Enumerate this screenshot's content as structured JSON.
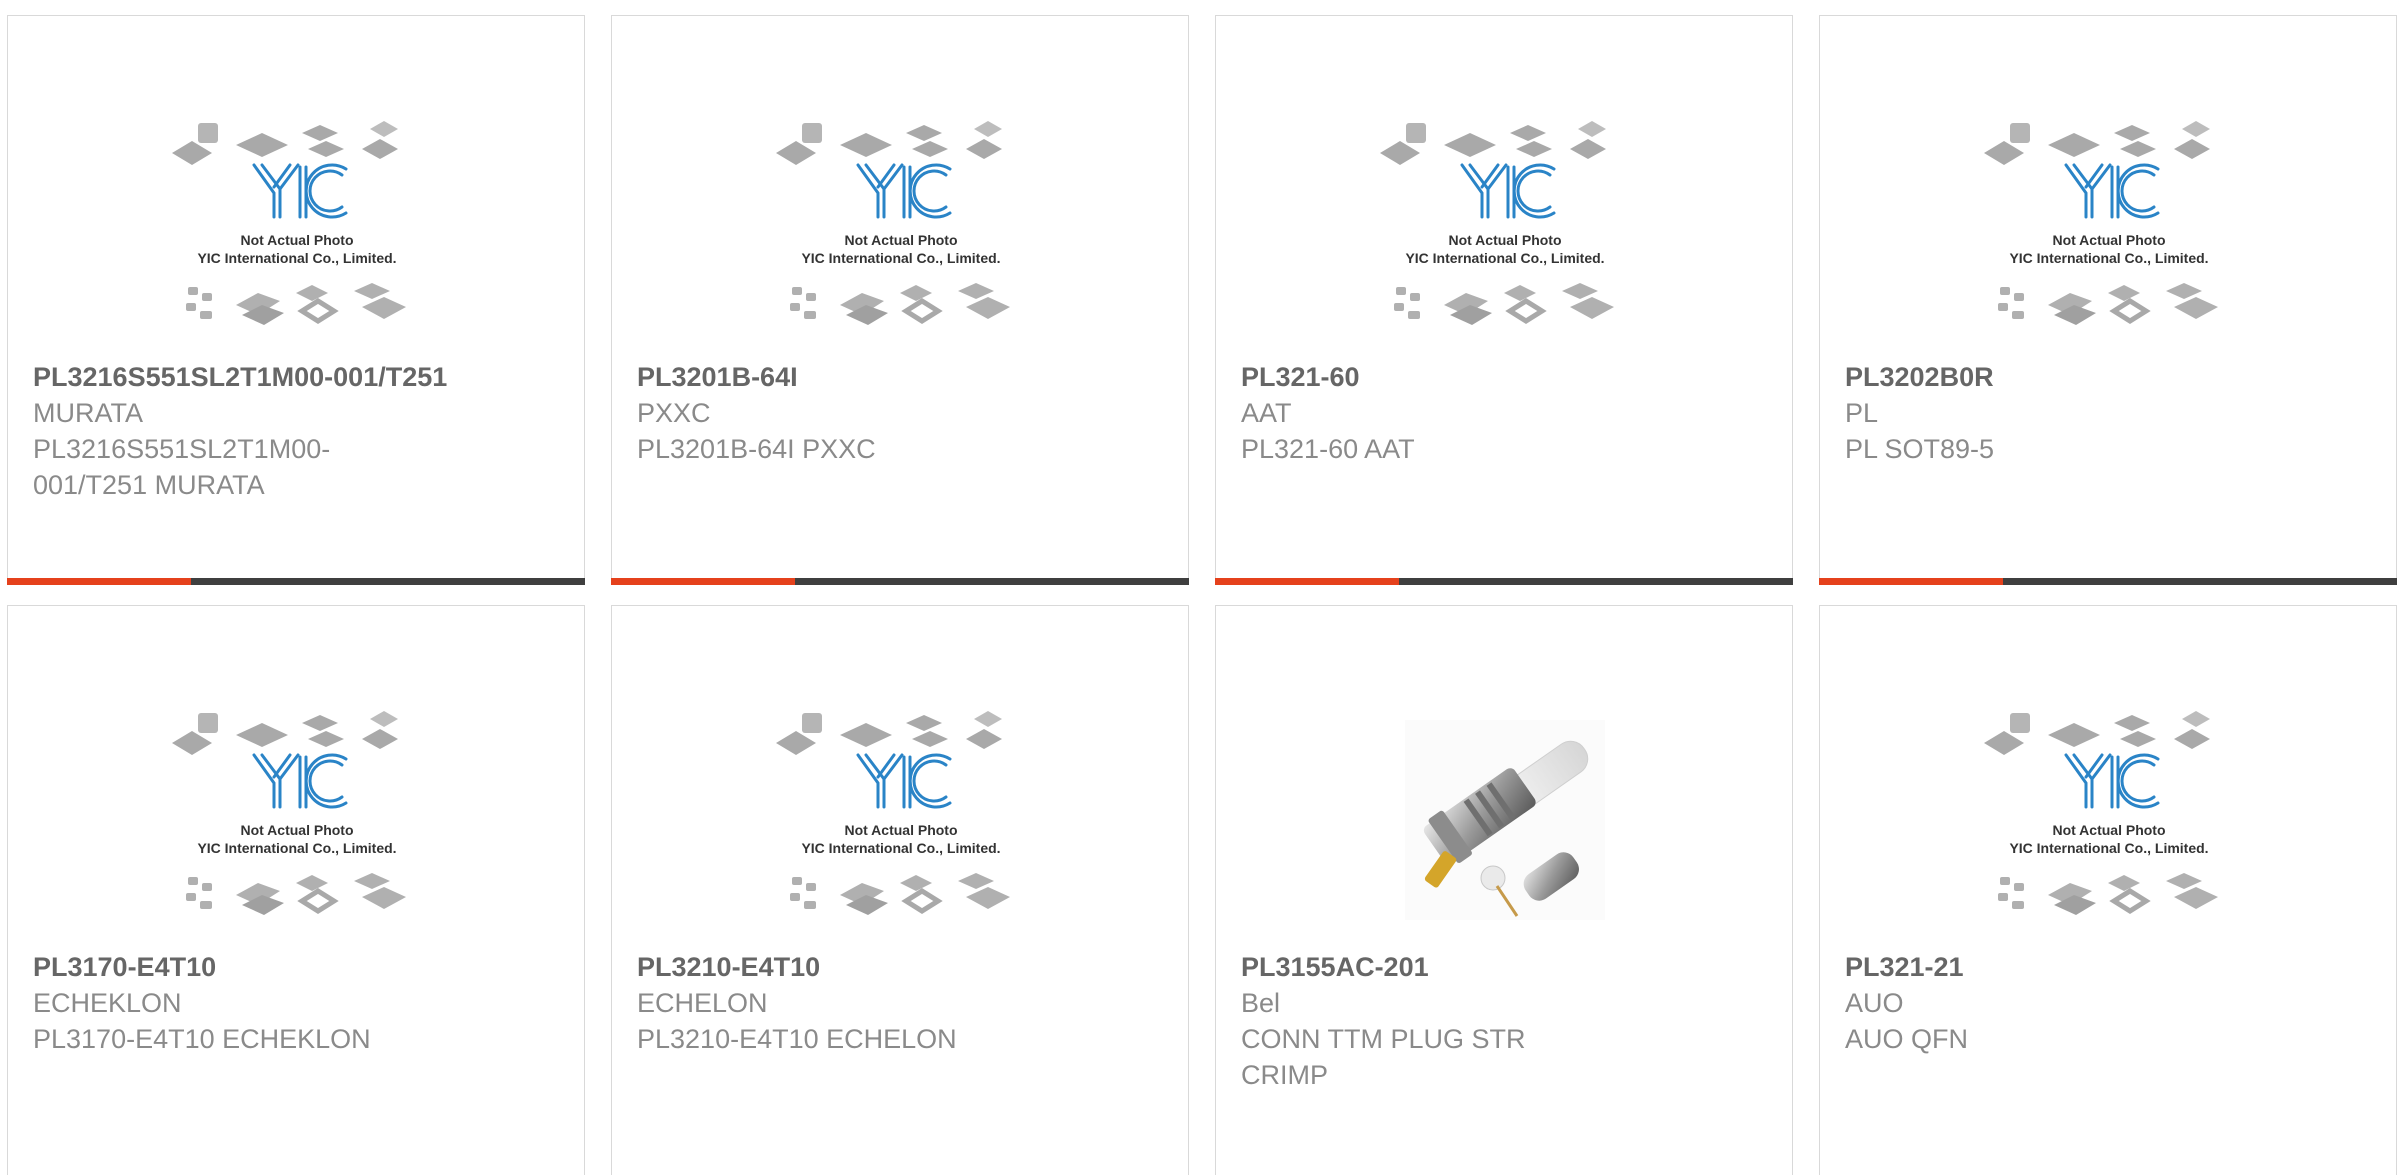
{
  "placeholder": {
    "line1": "Not Actual Photo",
    "line2": "YIC International Co., Limited."
  },
  "colors": {
    "accent": "#e5411c",
    "bar_dark": "#3f3f3f",
    "logo_blue": "#2a84c7"
  },
  "products": [
    {
      "part": "PL3216S551SL2T1M00-001/T251",
      "manufacturer": "MURATA",
      "description": "PL3216S551SL2T1M00-001/T251 MURATA",
      "image": "placeholder"
    },
    {
      "part": "PL3201B-64I",
      "manufacturer": "PXXC",
      "description": "PL3201B-64I PXXC",
      "image": "placeholder"
    },
    {
      "part": "PL321-60",
      "manufacturer": "AAT",
      "description": "PL321-60 AAT",
      "image": "placeholder"
    },
    {
      "part": "PL3202B0R",
      "manufacturer": "PL",
      "description": "PL SOT89-5",
      "image": "placeholder"
    },
    {
      "part": "PL3170-E4T10",
      "manufacturer": "ECHEKLON",
      "description": "PL3170-E4T10 ECHEKLON",
      "image": "placeholder"
    },
    {
      "part": "PL3210-E4T10",
      "manufacturer": "ECHELON",
      "description": "PL3210-E4T10 ECHELON",
      "image": "placeholder"
    },
    {
      "part": "PL3155AC-201",
      "manufacturer": "Bel",
      "description": "CONN TTM PLUG STR CRIMP",
      "image": "connector-photo"
    },
    {
      "part": "PL321-21",
      "manufacturer": "AUO",
      "description": "AUO QFN",
      "image": "placeholder"
    }
  ]
}
